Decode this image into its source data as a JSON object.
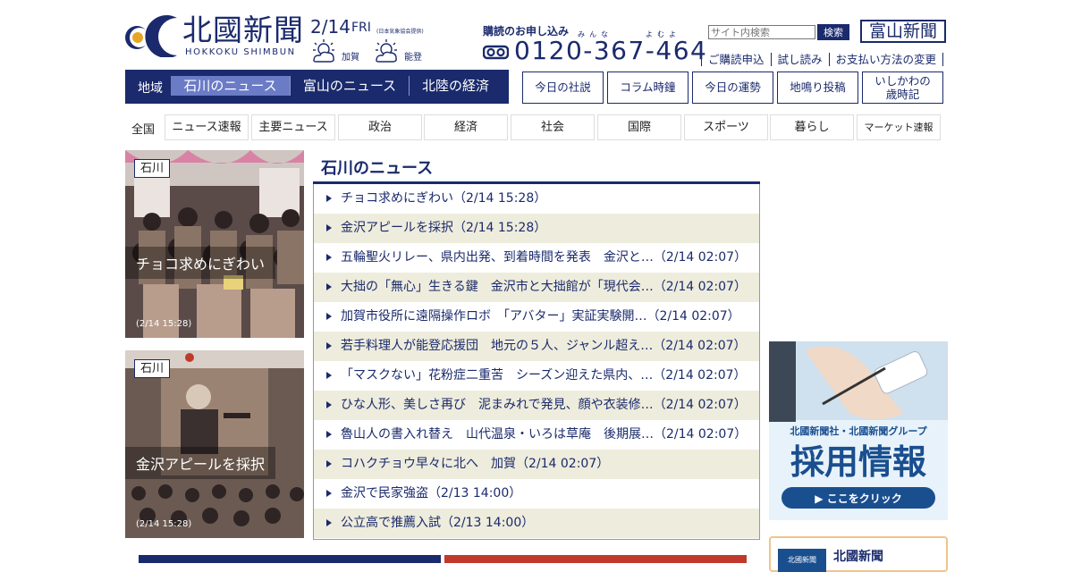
{
  "header": {
    "logo_jp": "北國新聞",
    "logo_en": "HOKKOKU SHIMBUN",
    "date": "2/14",
    "day_of_week": "FRI",
    "weather_credit": "(日本気象協会提供)",
    "weather": [
      {
        "place": "加賀",
        "icon": "sun-cloud-icon"
      },
      {
        "place": "能登",
        "icon": "sun-cloud-icon"
      }
    ],
    "subscribe_label": "購読のお申し込み",
    "subscribe_ruby": [
      "みんな",
      "よむよ"
    ],
    "phone": "0120-367-464",
    "search_placeholder": "サイト内検索",
    "search_button": "検索",
    "toyama_link": "富山新聞",
    "links": [
      "ご購読申込",
      "試し読み",
      "お支払い方法の変更"
    ]
  },
  "region_nav": {
    "label": "地域",
    "tabs": [
      "石川のニュース",
      "富山のニュース",
      "北陸の経済"
    ],
    "active": 0
  },
  "box_buttons": [
    "今日の社説",
    "コラム時鐘",
    "今日の運勢",
    "地鳴り投稿",
    "いしかわの\n歳時記"
  ],
  "categories": {
    "all_label": "全国",
    "tabs": [
      "ニュース速報",
      "主要ニュース",
      "政治",
      "経済",
      "社会",
      "国際",
      "スポーツ",
      "暮らし",
      "マーケット速報"
    ]
  },
  "photos": [
    {
      "tag": "石川",
      "caption": "チョコ求めにぎわい",
      "time": "(2/14 15:28)"
    },
    {
      "tag": "石川",
      "caption": "金沢アピールを採択",
      "time": "(2/14 15:28)"
    }
  ],
  "news": {
    "title": "石川のニュース",
    "items": [
      "チョコ求めにぎわい（2/14 15:28）",
      "金沢アピールを採択（2/14 15:28）",
      "五輪聖火リレー、県内出発、到着時間を発表　金沢と…（2/14 02:07）",
      "大拙の「無心」生きる鍵　金沢市と大拙館が「現代会…（2/14 02:07）",
      "加賀市役所に遠隔操作ロボ　「アバター」実証実験開…（2/14 02:07）",
      "若手料理人が能登応援団　地元の５人、ジャンル超え…（2/14 02:07）",
      "「マスクない」花粉症二重苦　シーズン迎えた県内、…（2/14 02:07）",
      "ひな人形、美しさ再び　泥まみれで発見、顔や衣装修…（2/14 02:07）",
      "魯山人の書入れ替え　山代温泉・いろは草庵　後期展…（2/14 02:07）",
      "コハクチョウ早々に北へ　加賀（2/14 02:07）",
      "金沢で民家強盗（2/13 14:00）",
      "公立高で推薦入試（2/13 14:00）"
    ]
  },
  "ad": {
    "line1": "北國新聞社・北國新聞グループ",
    "line2": "採用情報",
    "button": "▶ ここをクリック"
  },
  "bottom_box": {
    "label": "北國新聞",
    "badge": "北國新聞"
  },
  "colors": {
    "navy": "#1a2a6c",
    "active_tab": "#6b7bc6",
    "alt_row": "#eeecdc"
  }
}
